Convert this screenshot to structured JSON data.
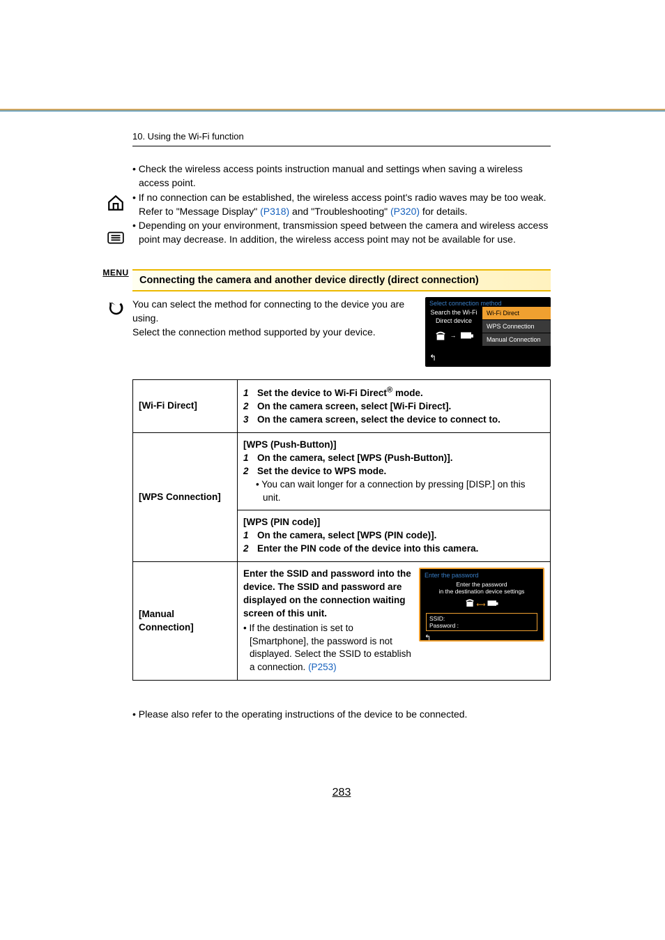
{
  "breadcrumb": "10. Using the Wi-Fi function",
  "sideNav": {
    "menu": "MENU"
  },
  "tips": [
    {
      "text": "Check the wireless access points instruction manual and settings when saving a wireless access point."
    },
    {
      "prefix": "If no connection can be established, the wireless access point's radio waves may be too weak. Refer to \"Message Display\" ",
      "link1": "(P318)",
      "mid": " and \"Troubleshooting\" ",
      "link2": "(P320)",
      "suffix": " for details."
    },
    {
      "text": "Depending on your environment, transmission speed between the camera and wireless access point may decrease. In addition, the wireless access point may not be available for use."
    }
  ],
  "sectionTitle": "Connecting the camera and another device directly (direct connection)",
  "intro": {
    "line1": "You can select the method for connecting to the device you are using.",
    "line2": "Select the connection method supported by your device."
  },
  "screen1": {
    "title": "Select connection method",
    "leftLine1": "Search the Wi-Fi",
    "leftLine2": "Direct device",
    "opt1": "Wi-Fi Direct",
    "opt2": "WPS Connection",
    "opt3": "Manual Connection",
    "back": "↰"
  },
  "table": {
    "row1": {
      "label": "[Wi-Fi Direct]",
      "s1": "Set the device to Wi-Fi Direct",
      "s1suffix": " mode.",
      "s2": "On the camera screen, select [Wi-Fi Direct].",
      "s3": "On the camera screen, select the device to connect to."
    },
    "row2a": {
      "label": "[WPS Connection]",
      "head": "[WPS (Push-Button)]",
      "s1": "On the camera, select [WPS (Push-Button)].",
      "s2": "Set the device to WPS mode.",
      "note": "You can wait longer for a connection by pressing [DISP.] on this unit."
    },
    "row2b": {
      "head": "[WPS (PIN code)]",
      "s1": "On the camera, select [WPS (PIN code)].",
      "s2": "Enter the PIN code of the device into this camera."
    },
    "row3": {
      "label": "[Manual Connection]",
      "lead": "Enter the SSID and password into the device. The SSID and password are displayed on the connection waiting screen of this unit.",
      "noteA": "If the destination is set to [Smartphone], the password is not displayed. Select the SSID to establish a connection. ",
      "noteLink": "(P253)"
    }
  },
  "screen2": {
    "title": "Enter the password",
    "sub": "Enter the password\nin the destination device settings",
    "ssidLabel": "SSID:",
    "ssidVal": " ",
    "pwLabel": "Password :",
    "pwVal": " ",
    "back": "↰"
  },
  "footerNote": "Please also refer to the operating instructions of the device to be connected.",
  "pageNumber": "283"
}
